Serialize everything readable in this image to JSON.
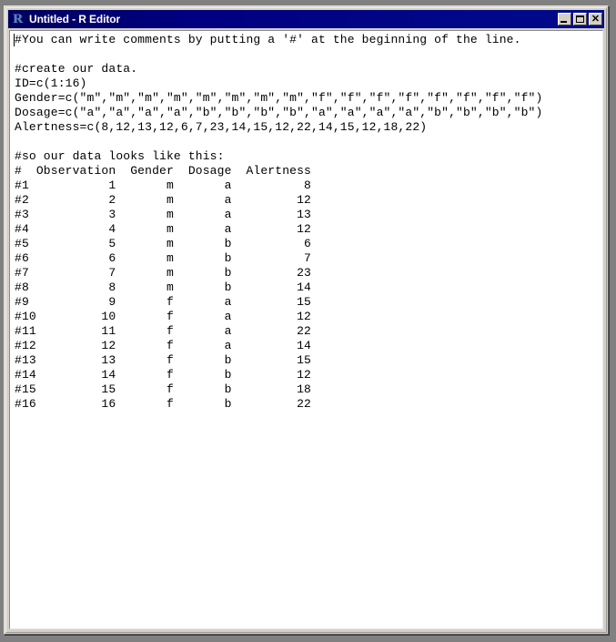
{
  "window": {
    "title": "Untitled - R Editor",
    "icon": "r-logo-icon",
    "icon_glyph": "R",
    "titlebar_color": "#000080",
    "client_bg": "#ffffff",
    "frame_bg": "#d4d0c8",
    "desktop_bg": "#808080",
    "buttons": {
      "minimize_label": "_",
      "maximize_label": "□",
      "close_label": "✕"
    }
  },
  "editor": {
    "text_color": "#000000",
    "font_size_px": 13,
    "line_height_px": 16,
    "content": "#You can write comments by putting a '#' at the beginning of the line.\n\n#create our data.\nID=c(1:16)\nGender=c(\"m\",\"m\",\"m\",\"m\",\"m\",\"m\",\"m\",\"m\",\"f\",\"f\",\"f\",\"f\",\"f\",\"f\",\"f\",\"f\")\nDosage=c(\"a\",\"a\",\"a\",\"a\",\"b\",\"b\",\"b\",\"b\",\"a\",\"a\",\"a\",\"a\",\"b\",\"b\",\"b\",\"b\")\nAlertness=c(8,12,13,12,6,7,23,14,15,12,22,14,15,12,18,22)\n\n#so our data looks like this:\n#  Observation  Gender  Dosage  Alertness\n#1           1       m       a          8\n#2           2       m       a         12\n#3           3       m       a         13\n#4           4       m       a         12\n#5           5       m       b          6\n#6           6       m       b          7\n#7           7       m       b         23\n#8           8       m       b         14\n#9           9       f       a         15\n#10         10       f       a         12\n#11         11       f       a         22\n#12         12       f       a         14\n#13         13       f       b         15\n#14         14       f       b         12\n#15         15       f       b         18\n#16         16       f       b         22",
    "lines": [
      "#You can write comments by putting a '#' at the beginning of the line.",
      "",
      "#create our data.",
      "ID=c(1:16)",
      "Gender=c(\"m\",\"m\",\"m\",\"m\",\"m\",\"m\",\"m\",\"m\",\"f\",\"f\",\"f\",\"f\",\"f\",\"f\",\"f\",\"f\")",
      "Dosage=c(\"a\",\"a\",\"a\",\"a\",\"b\",\"b\",\"b\",\"b\",\"a\",\"a\",\"a\",\"a\",\"b\",\"b\",\"b\",\"b\")",
      "Alertness=c(8,12,13,12,6,7,23,14,15,12,22,14,15,12,18,22)",
      "",
      "#so our data looks like this:",
      "#  Observation  Gender  Dosage  Alertness",
      "#1           1       m       a          8",
      "#2           2       m       a         12",
      "#3           3       m       a         13",
      "#4           4       m       a         12",
      "#5           5       m       b          6",
      "#6           6       m       b          7",
      "#7           7       m       b         23",
      "#8           8       m       b         14",
      "#9           9       f       a         15",
      "#10         10       f       a         12",
      "#11         11       f       a         22",
      "#12         12       f       a         14",
      "#13         13       f       b         15",
      "#14         14       f       b         12",
      "#15         15       f       b         18",
      "#16         16       f       b         22"
    ],
    "variables": {
      "ID": "c(1:16)",
      "Gender": [
        "m",
        "m",
        "m",
        "m",
        "m",
        "m",
        "m",
        "m",
        "f",
        "f",
        "f",
        "f",
        "f",
        "f",
        "f",
        "f"
      ],
      "Dosage": [
        "a",
        "a",
        "a",
        "a",
        "b",
        "b",
        "b",
        "b",
        "a",
        "a",
        "a",
        "a",
        "b",
        "b",
        "b",
        "b"
      ],
      "Alertness": [
        8,
        12,
        13,
        12,
        6,
        7,
        23,
        14,
        15,
        12,
        22,
        14,
        15,
        12,
        18,
        22
      ]
    },
    "data_table": {
      "headers": [
        "#",
        "Observation",
        "Gender",
        "Dosage",
        "Alertness"
      ],
      "rows": [
        [
          "#1",
          "1",
          "m",
          "a",
          "8"
        ],
        [
          "#2",
          "2",
          "m",
          "a",
          "12"
        ],
        [
          "#3",
          "3",
          "m",
          "a",
          "13"
        ],
        [
          "#4",
          "4",
          "m",
          "a",
          "12"
        ],
        [
          "#5",
          "5",
          "m",
          "b",
          "6"
        ],
        [
          "#6",
          "6",
          "m",
          "b",
          "7"
        ],
        [
          "#7",
          "7",
          "m",
          "b",
          "23"
        ],
        [
          "#8",
          "8",
          "m",
          "b",
          "14"
        ],
        [
          "#9",
          "9",
          "f",
          "a",
          "15"
        ],
        [
          "#10",
          "10",
          "f",
          "a",
          "12"
        ],
        [
          "#11",
          "11",
          "f",
          "a",
          "22"
        ],
        [
          "#12",
          "12",
          "f",
          "a",
          "14"
        ],
        [
          "#13",
          "13",
          "f",
          "b",
          "15"
        ],
        [
          "#14",
          "14",
          "f",
          "b",
          "12"
        ],
        [
          "#15",
          "15",
          "f",
          "b",
          "18"
        ],
        [
          "#16",
          "16",
          "f",
          "b",
          "22"
        ]
      ]
    }
  }
}
